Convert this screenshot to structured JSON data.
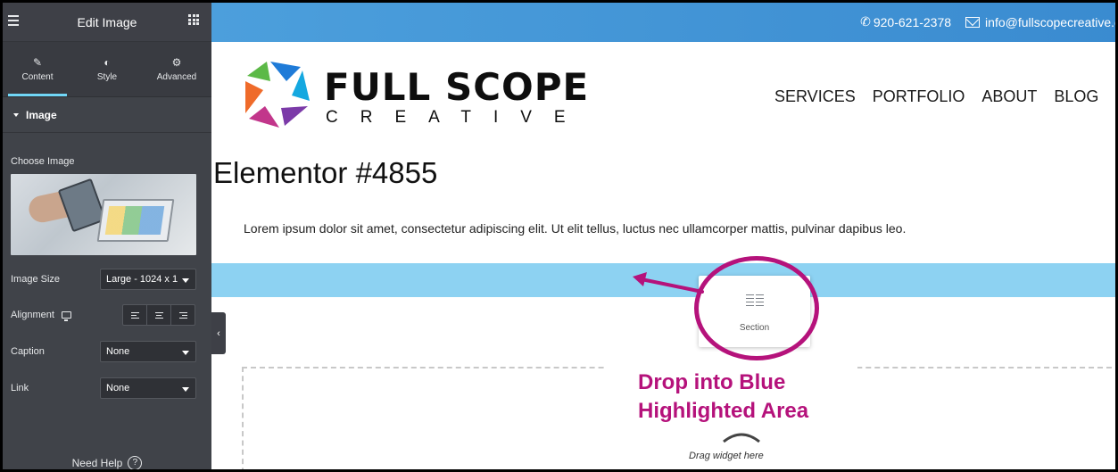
{
  "sidebar": {
    "title": "Edit Image",
    "tabs": [
      {
        "label": "Content",
        "icon": "pencil-icon",
        "active": true
      },
      {
        "label": "Style",
        "icon": "contrast-icon",
        "active": false
      },
      {
        "label": "Advanced",
        "icon": "gear-icon",
        "active": false
      }
    ],
    "section": "Image",
    "choose_image": "Choose Image",
    "image_size_label": "Image Size",
    "image_size_value": "Large - 1024 x 1",
    "alignment_label": "Alignment",
    "caption_label": "Caption",
    "caption_value": "None",
    "link_label": "Link",
    "link_value": "None",
    "need_help": "Need Help"
  },
  "site": {
    "phone": "920-621-2378",
    "email": "info@fullscopecreative.c",
    "brand_main": "FULL SCOPE",
    "brand_sub": "CREATIVE",
    "nav": [
      "SERVICES",
      "PORTFOLIO",
      "ABOUT",
      "BLOG"
    ],
    "page_title": "Elementor #4855",
    "paragraph": "Lorem ipsum dolor sit amet, consectetur adipiscing elit. Ut elit tellus, luctus nec ullamcorper mattis, pulvinar dapibus leo."
  },
  "drag": {
    "widget_label": "Section",
    "annotation_line1": "Drop into Blue",
    "annotation_line2": "Highlighted Area",
    "drag_hint": "Drag widget here"
  },
  "colors": {
    "sidebar_bg": "#404349",
    "topbar": "#3a8bd0",
    "drop_highlight": "#8dd2f2",
    "annotation": "#b5127b",
    "active_tab": "#71d7f7"
  }
}
